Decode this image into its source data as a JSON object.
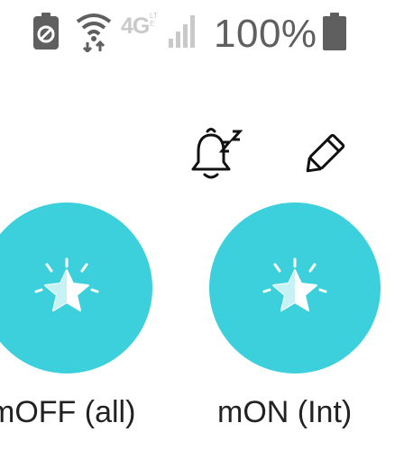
{
  "status_bar": {
    "battery_percent": "100%",
    "network_label": "4G",
    "network_sub_label": "LTE",
    "icons": {
      "saver": "battery-saver-icon",
      "wifi": "wifi-icon",
      "network": "network-4g-lte-icon",
      "signal": "signal-strength-icon",
      "battery": "battery-icon"
    }
  },
  "toolbar": {
    "snooze_icon": "snooze-bell-icon",
    "edit_icon": "pencil-edit-icon"
  },
  "tiles": [
    {
      "label": "mOFF (all)",
      "icon": "star-icon"
    },
    {
      "label": "mON (Int)",
      "icon": "star-icon"
    }
  ],
  "colors": {
    "accent": "#3ccfdc",
    "star_fill": "#c6f2f5",
    "status_gray": "#5f5f5f",
    "text": "#222222"
  }
}
